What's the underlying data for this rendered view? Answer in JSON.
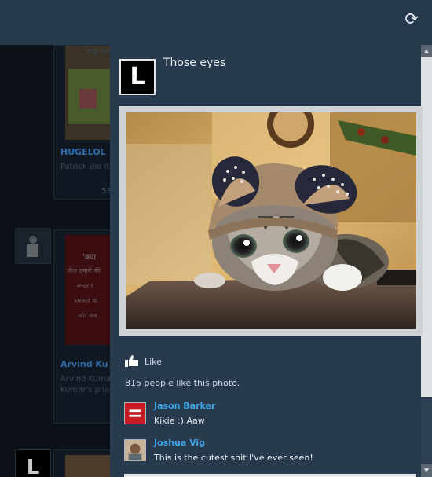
{
  "header": {
    "refresh_icon": "refresh-icon"
  },
  "background_feed": {
    "card1": {
      "title": "HUGELOL",
      "subtitle": "Patrick did it",
      "count": "53",
      "top_text": "ing boy"
    },
    "card2": {
      "title": "Arvind Ku",
      "subtitle_line1": "Arvind Kuma",
      "subtitle_line2": "Kumar's pho",
      "poster_lines": [
        "'क्या",
        "चीज हमारी की",
        "अन्दर र",
        "सरकार क",
        "और जब"
      ]
    }
  },
  "post": {
    "avatar_letter": "L",
    "text": "Those eyes",
    "like_label": "Like",
    "likes_text": "815 people like this photo.",
    "comments": [
      {
        "name": "Jason Barker",
        "text": "Kikie :) Aaw",
        "avatar": "equality-logo"
      },
      {
        "name": "Joshua Vig",
        "text": "This is the cutest shit I've ever seen!",
        "avatar": "profile-photo"
      }
    ]
  },
  "colors": {
    "panel": "#273a4e",
    "link": "#3ea6e6"
  }
}
